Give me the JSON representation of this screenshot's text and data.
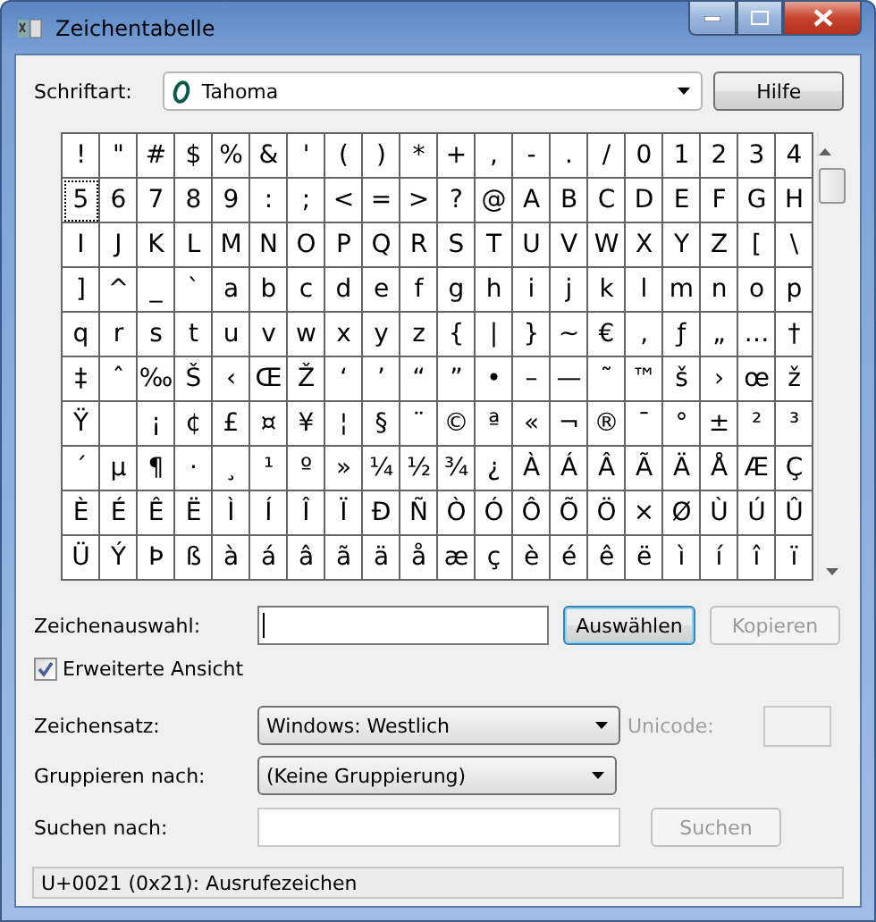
{
  "window": {
    "title": "Zeichentabelle"
  },
  "font": {
    "label": "Schriftart:",
    "value": "Tahoma"
  },
  "help_button": {
    "label": "Hilfe"
  },
  "grid": {
    "rows": [
      [
        {
          "c": "!",
          "focused": false
        },
        {
          "c": "\"",
          "focused": false
        },
        {
          "c": "#",
          "focused": false
        },
        {
          "c": "$",
          "focused": false
        },
        {
          "c": "%",
          "focused": false
        },
        {
          "c": "&",
          "focused": false
        },
        {
          "c": "'",
          "focused": false
        },
        {
          "c": "(",
          "focused": false
        },
        {
          "c": ")",
          "focused": false
        },
        {
          "c": "*",
          "focused": false
        },
        {
          "c": "+",
          "focused": false
        },
        {
          "c": ",",
          "focused": false
        },
        {
          "c": "-",
          "focused": false
        },
        {
          "c": ".",
          "focused": false
        },
        {
          "c": "/",
          "focused": false
        },
        {
          "c": "0",
          "focused": false
        },
        {
          "c": "1",
          "focused": false
        },
        {
          "c": "2",
          "focused": false
        },
        {
          "c": "3",
          "focused": false
        },
        {
          "c": "4",
          "focused": false
        }
      ],
      [
        {
          "c": "5",
          "focused": true
        },
        {
          "c": "6",
          "focused": false
        },
        {
          "c": "7",
          "focused": false
        },
        {
          "c": "8",
          "focused": false
        },
        {
          "c": "9",
          "focused": false
        },
        {
          "c": ":",
          "focused": false
        },
        {
          "c": ";",
          "focused": false
        },
        {
          "c": "<",
          "focused": false
        },
        {
          "c": "=",
          "focused": false
        },
        {
          "c": ">",
          "focused": false
        },
        {
          "c": "?",
          "focused": false
        },
        {
          "c": "@",
          "focused": false
        },
        {
          "c": "A",
          "focused": false
        },
        {
          "c": "B",
          "focused": false
        },
        {
          "c": "C",
          "focused": false
        },
        {
          "c": "D",
          "focused": false
        },
        {
          "c": "E",
          "focused": false
        },
        {
          "c": "F",
          "focused": false
        },
        {
          "c": "G",
          "focused": false
        },
        {
          "c": "H",
          "focused": false
        }
      ],
      [
        {
          "c": "I",
          "focused": false
        },
        {
          "c": "J",
          "focused": false
        },
        {
          "c": "K",
          "focused": false
        },
        {
          "c": "L",
          "focused": false
        },
        {
          "c": "M",
          "focused": false
        },
        {
          "c": "N",
          "focused": false
        },
        {
          "c": "O",
          "focused": false
        },
        {
          "c": "P",
          "focused": false
        },
        {
          "c": "Q",
          "focused": false
        },
        {
          "c": "R",
          "focused": false
        },
        {
          "c": "S",
          "focused": false
        },
        {
          "c": "T",
          "focused": false
        },
        {
          "c": "U",
          "focused": false
        },
        {
          "c": "V",
          "focused": false
        },
        {
          "c": "W",
          "focused": false
        },
        {
          "c": "X",
          "focused": false
        },
        {
          "c": "Y",
          "focused": false
        },
        {
          "c": "Z",
          "focused": false
        },
        {
          "c": "[",
          "focused": false
        },
        {
          "c": "\\",
          "focused": false
        }
      ],
      [
        {
          "c": "]",
          "focused": false
        },
        {
          "c": "^",
          "focused": false
        },
        {
          "c": "_",
          "focused": false
        },
        {
          "c": "`",
          "focused": false
        },
        {
          "c": "a",
          "focused": false
        },
        {
          "c": "b",
          "focused": false
        },
        {
          "c": "c",
          "focused": false
        },
        {
          "c": "d",
          "focused": false
        },
        {
          "c": "e",
          "focused": false
        },
        {
          "c": "f",
          "focused": false
        },
        {
          "c": "g",
          "focused": false
        },
        {
          "c": "h",
          "focused": false
        },
        {
          "c": "i",
          "focused": false
        },
        {
          "c": "j",
          "focused": false
        },
        {
          "c": "k",
          "focused": false
        },
        {
          "c": "l",
          "focused": false
        },
        {
          "c": "m",
          "focused": false
        },
        {
          "c": "n",
          "focused": false
        },
        {
          "c": "o",
          "focused": false
        },
        {
          "c": "p",
          "focused": false
        }
      ],
      [
        {
          "c": "q",
          "focused": false
        },
        {
          "c": "r",
          "focused": false
        },
        {
          "c": "s",
          "focused": false
        },
        {
          "c": "t",
          "focused": false
        },
        {
          "c": "u",
          "focused": false
        },
        {
          "c": "v",
          "focused": false
        },
        {
          "c": "w",
          "focused": false
        },
        {
          "c": "x",
          "focused": false
        },
        {
          "c": "y",
          "focused": false
        },
        {
          "c": "z",
          "focused": false
        },
        {
          "c": "{",
          "focused": false
        },
        {
          "c": "|",
          "focused": false
        },
        {
          "c": "}",
          "focused": false
        },
        {
          "c": "~",
          "focused": false
        },
        {
          "c": "€",
          "focused": false
        },
        {
          "c": "‚",
          "focused": false
        },
        {
          "c": "ƒ",
          "focused": false
        },
        {
          "c": "„",
          "focused": false
        },
        {
          "c": "…",
          "focused": false
        },
        {
          "c": "†",
          "focused": false
        }
      ],
      [
        {
          "c": "‡",
          "focused": false
        },
        {
          "c": "ˆ",
          "focused": false
        },
        {
          "c": "‰",
          "focused": false
        },
        {
          "c": "Š",
          "focused": false
        },
        {
          "c": "‹",
          "focused": false
        },
        {
          "c": "Œ",
          "focused": false
        },
        {
          "c": "Ž",
          "focused": false
        },
        {
          "c": "‘",
          "focused": false
        },
        {
          "c": "’",
          "focused": false
        },
        {
          "c": "“",
          "focused": false
        },
        {
          "c": "”",
          "focused": false
        },
        {
          "c": "•",
          "focused": false
        },
        {
          "c": "–",
          "focused": false
        },
        {
          "c": "—",
          "focused": false
        },
        {
          "c": "˜",
          "focused": false
        },
        {
          "c": "™",
          "focused": false
        },
        {
          "c": "š",
          "focused": false
        },
        {
          "c": "›",
          "focused": false
        },
        {
          "c": "œ",
          "focused": false
        },
        {
          "c": "ž",
          "focused": false
        }
      ],
      [
        {
          "c": "Ÿ",
          "focused": false
        },
        {
          "focused": false
        },
        {
          "c": "¡",
          "focused": false
        },
        {
          "c": "¢",
          "focused": false
        },
        {
          "c": "£",
          "focused": false
        },
        {
          "c": "¤",
          "focused": false
        },
        {
          "c": "¥",
          "focused": false
        },
        {
          "c": "¦",
          "focused": false
        },
        {
          "c": "§",
          "focused": false
        },
        {
          "c": "¨",
          "focused": false
        },
        {
          "c": "©",
          "focused": false
        },
        {
          "c": "ª",
          "focused": false
        },
        {
          "c": "«",
          "focused": false
        },
        {
          "c": "¬",
          "focused": false
        },
        {
          "c": "®",
          "focused": false
        },
        {
          "c": "¯",
          "focused": false
        },
        {
          "c": "°",
          "focused": false
        },
        {
          "c": "±",
          "focused": false
        },
        {
          "c": "²",
          "focused": false
        },
        {
          "c": "³",
          "focused": false
        }
      ],
      [
        {
          "c": "´",
          "focused": false
        },
        {
          "c": "µ",
          "focused": false
        },
        {
          "c": "¶",
          "focused": false
        },
        {
          "c": "·",
          "focused": false
        },
        {
          "c": "¸",
          "focused": false
        },
        {
          "c": "¹",
          "focused": false
        },
        {
          "c": "º",
          "focused": false
        },
        {
          "c": "»",
          "focused": false
        },
        {
          "c": "¼",
          "focused": false
        },
        {
          "c": "½",
          "focused": false
        },
        {
          "c": "¾",
          "focused": false
        },
        {
          "c": "¿",
          "focused": false
        },
        {
          "c": "À",
          "focused": false
        },
        {
          "c": "Á",
          "focused": false
        },
        {
          "c": "Â",
          "focused": false
        },
        {
          "c": "Ã",
          "focused": false
        },
        {
          "c": "Ä",
          "focused": false
        },
        {
          "c": "Å",
          "focused": false
        },
        {
          "c": "Æ",
          "focused": false
        },
        {
          "c": "Ç",
          "focused": false
        }
      ],
      [
        {
          "c": "È",
          "focused": false
        },
        {
          "c": "É",
          "focused": false
        },
        {
          "c": "Ê",
          "focused": false
        },
        {
          "c": "Ë",
          "focused": false
        },
        {
          "c": "Ì",
          "focused": false
        },
        {
          "c": "Í",
          "focused": false
        },
        {
          "c": "Î",
          "focused": false
        },
        {
          "c": "Ï",
          "focused": false
        },
        {
          "c": "Ð",
          "focused": false
        },
        {
          "c": "Ñ",
          "focused": false
        },
        {
          "c": "Ò",
          "focused": false
        },
        {
          "c": "Ó",
          "focused": false
        },
        {
          "c": "Ô",
          "focused": false
        },
        {
          "c": "Õ",
          "focused": false
        },
        {
          "c": "Ö",
          "focused": false
        },
        {
          "c": "×",
          "focused": false
        },
        {
          "c": "Ø",
          "focused": false
        },
        {
          "c": "Ù",
          "focused": false
        },
        {
          "c": "Ú",
          "focused": false
        },
        {
          "c": "Û",
          "focused": false
        }
      ],
      [
        {
          "c": "Ü",
          "focused": false
        },
        {
          "c": "Ý",
          "focused": false
        },
        {
          "c": "Þ",
          "focused": false
        },
        {
          "c": "ß",
          "focused": false
        },
        {
          "c": "à",
          "focused": false
        },
        {
          "c": "á",
          "focused": false
        },
        {
          "c": "â",
          "focused": false
        },
        {
          "c": "ã",
          "focused": false
        },
        {
          "c": "ä",
          "focused": false
        },
        {
          "c": "å",
          "focused": false
        },
        {
          "c": "æ",
          "focused": false
        },
        {
          "c": "ç",
          "focused": false
        },
        {
          "c": "è",
          "focused": false
        },
        {
          "c": "é",
          "focused": false
        },
        {
          "c": "ê",
          "focused": false
        },
        {
          "c": "ë",
          "focused": false
        },
        {
          "c": "ì",
          "focused": false
        },
        {
          "c": "í",
          "focused": false
        },
        {
          "c": "î",
          "focused": false
        },
        {
          "c": "ï",
          "focused": false
        }
      ]
    ]
  },
  "selection": {
    "label": "Zeichenauswahl:",
    "select_button": {
      "label": "Auswählen",
      "disabled": false
    },
    "copy_button": {
      "label": "Kopieren",
      "disabled": true
    }
  },
  "advanced_view": {
    "label": "Erweiterte Ansicht",
    "checked": true
  },
  "charset": {
    "label": "Zeichensatz:",
    "value": "Windows: Westlich"
  },
  "unicode": {
    "label": "Unicode:",
    "disabled": true
  },
  "group_by": {
    "label": "Gruppieren nach:",
    "value": "(Keine Gruppierung)"
  },
  "search": {
    "label": "Suchen nach:",
    "button": {
      "label": "Suchen",
      "disabled": true
    }
  },
  "status_bar": {
    "text": "U+0021 (0x21): Ausrufezeichen"
  }
}
